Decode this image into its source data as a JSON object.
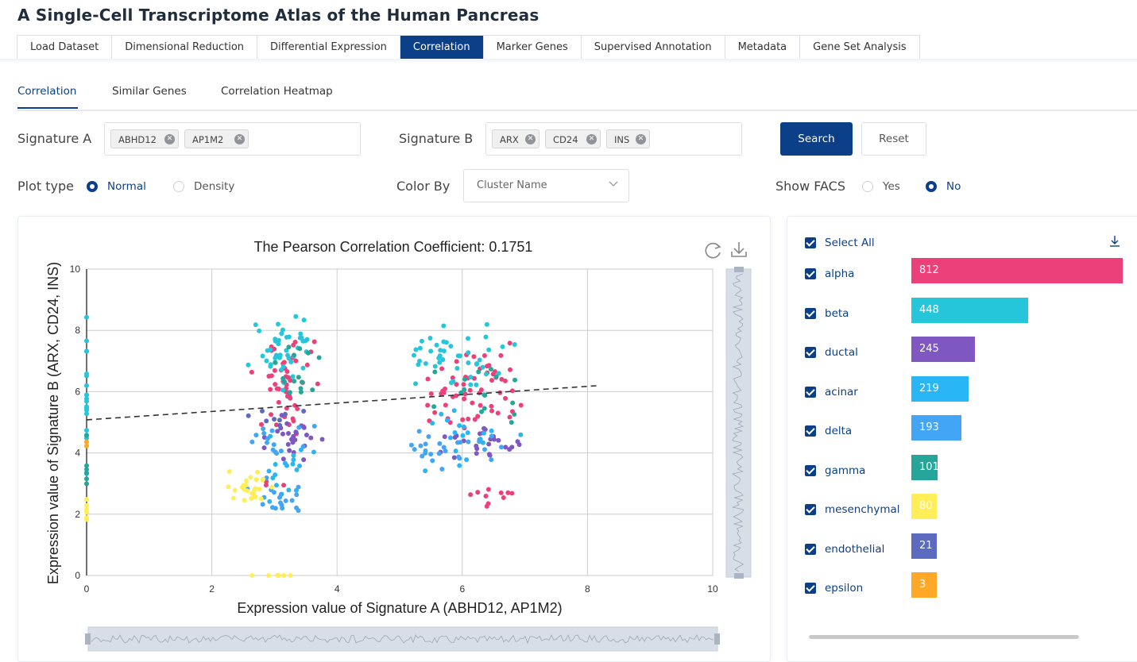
{
  "app": {
    "title": "A Single-Cell Transcriptome Atlas of the Human Pancreas"
  },
  "main_tabs": [
    "Load Dataset",
    "Dimensional Reduction",
    "Differential Expression",
    "Correlation",
    "Marker Genes",
    "Supervised Annotation",
    "Metadata",
    "Gene Set Analysis"
  ],
  "main_tab_active": "Correlation",
  "sub_tabs": [
    "Correlation",
    "Similar Genes",
    "Correlation Heatmap"
  ],
  "sub_tab_active": "Correlation",
  "form": {
    "signature_a": {
      "label": "Signature A",
      "tags": [
        "ABHD12",
        "AP1M2"
      ]
    },
    "signature_b": {
      "label": "Signature B",
      "tags": [
        "ARX",
        "CD24",
        "INS"
      ]
    },
    "search_label": "Search",
    "reset_label": "Reset",
    "plot_type": {
      "label": "Plot type",
      "options": [
        "Normal",
        "Density"
      ],
      "selected": "Normal"
    },
    "color_by": {
      "label": "Color By",
      "value": "Cluster Name"
    },
    "show_facs": {
      "label": "Show FACS",
      "options": [
        "Yes",
        "No"
      ],
      "selected": "No"
    }
  },
  "legend": {
    "select_all": "Select All",
    "items": [
      {
        "name": "alpha",
        "count": "812",
        "color": "#ec407a"
      },
      {
        "name": "beta",
        "count": "448",
        "color": "#26c6da"
      },
      {
        "name": "ductal",
        "count": "245",
        "color": "#7e57c2"
      },
      {
        "name": "acinar",
        "count": "219",
        "color": "#29b6f6"
      },
      {
        "name": "delta",
        "count": "193",
        "color": "#42a5f5"
      },
      {
        "name": "gamma",
        "count": "101",
        "color": "#26a69a"
      },
      {
        "name": "mesenchymal",
        "count": "80",
        "color": "#ffee58"
      },
      {
        "name": "endothelial",
        "count": "21",
        "color": "#5c6bc0"
      },
      {
        "name": "epsilon",
        "count": "3",
        "color": "#ffa726"
      }
    ]
  },
  "chart_data": {
    "type": "scatter",
    "title": "The Pearson Correlation Coefficient: 0.1751",
    "xlabel": "Expression value of Signature A (ABHD12, AP1M2)",
    "ylabel": "Expression value of Signature B (ARX, CD24, INS)",
    "xlim": [
      0,
      10
    ],
    "ylim": [
      0,
      10
    ],
    "xticks": [
      "0",
      "2",
      "4",
      "6",
      "8",
      "10"
    ],
    "yticks": [
      "0",
      "2",
      "4",
      "6",
      "8",
      "10"
    ],
    "grid": true,
    "trendline": {
      "x": [
        0,
        8.2
      ],
      "y": [
        5.08,
        6.2
      ]
    },
    "clusters": [
      {
        "name": "alpha",
        "color": "#ec407a",
        "groups": [
          [
            3.3,
            6.2,
            0.45,
            1.4,
            50
          ],
          [
            6.2,
            6.1,
            0.8,
            1.3,
            60
          ],
          [
            2.9,
            3.0,
            0.2,
            0.3,
            3
          ],
          [
            6.6,
            2.6,
            0.5,
            0.3,
            10
          ]
        ]
      },
      {
        "name": "beta",
        "color": "#26c6da",
        "groups": [
          [
            3.2,
            7.4,
            0.45,
            0.9,
            45
          ],
          [
            6.0,
            7.0,
            0.8,
            1.0,
            45
          ],
          [
            0,
            6.5,
            0,
            2.2,
            20
          ]
        ]
      },
      {
        "name": "ductal",
        "color": "#7e57c2",
        "groups": [
          [
            3.3,
            4.4,
            0.5,
            0.8,
            25
          ],
          [
            6.3,
            4.3,
            0.7,
            0.6,
            25
          ]
        ]
      },
      {
        "name": "acinar",
        "color": "#29b6f6",
        "groups": [
          [
            3.2,
            3.5,
            0.5,
            1.0,
            20
          ],
          [
            6.0,
            4.5,
            0.8,
            1.0,
            20
          ]
        ]
      },
      {
        "name": "delta",
        "color": "#42a5f5",
        "groups": [
          [
            3.1,
            2.4,
            0.4,
            0.5,
            18
          ],
          [
            5.9,
            4.1,
            0.8,
            0.5,
            25
          ],
          [
            3.0,
            4.5,
            0.6,
            0.6,
            15
          ]
        ]
      },
      {
        "name": "gamma",
        "color": "#26a69a",
        "groups": [
          [
            3.4,
            6.5,
            0.4,
            1.2,
            15
          ],
          [
            6.3,
            5.9,
            0.7,
            1.0,
            15
          ],
          [
            0,
            3.5,
            0,
            1.0,
            6
          ]
        ]
      },
      {
        "name": "mesenchymal",
        "color": "#ffee58",
        "groups": [
          [
            2.6,
            2.8,
            0.3,
            0.6,
            25
          ],
          [
            0,
            2.0,
            0,
            0.5,
            6
          ],
          [
            3.0,
            0,
            0.4,
            0,
            8
          ]
        ]
      },
      {
        "name": "endothelial",
        "color": "#5c6bc0",
        "groups": [
          [
            3.1,
            5.4,
            0.4,
            0.5,
            8
          ]
        ]
      },
      {
        "name": "epsilon",
        "color": "#ffa726",
        "groups": [
          [
            0,
            4.3,
            0,
            0.3,
            2
          ]
        ]
      }
    ]
  }
}
